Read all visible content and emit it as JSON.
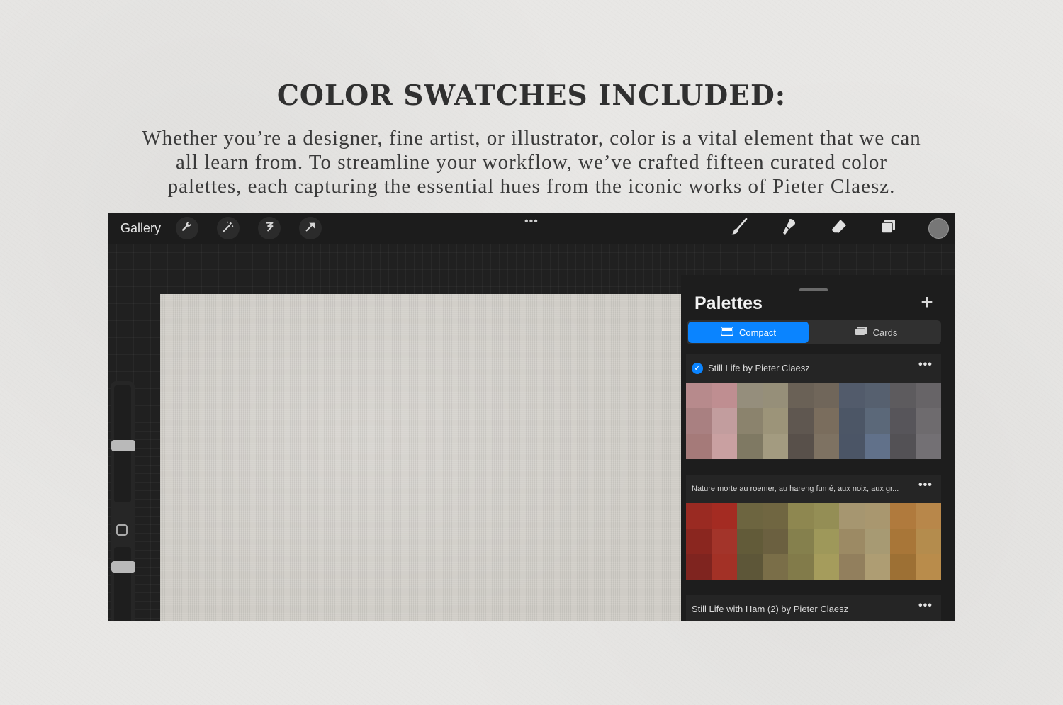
{
  "headline": "COLOR SWATCHES INCLUDED:",
  "intro": "Whether you’re a designer, fine artist, or illustrator, color is a vital element that we can all learn from. To streamline your workflow, we’ve crafted fifteen curated color palettes, each capturing the essential hues from the iconic works of Pieter Claesz.",
  "toolbar": {
    "gallery_label": "Gallery",
    "more_dots": "•••",
    "left_tools": [
      "wrench-icon",
      "magic-wand-icon",
      "selection-icon",
      "transform-arrow-icon"
    ],
    "right_tools": [
      "brush-icon",
      "smudge-icon",
      "eraser-icon",
      "layers-icon"
    ],
    "current_color": "#777777"
  },
  "panel": {
    "title": "Palettes",
    "add_symbol": "+",
    "tabs": [
      {
        "label": "Compact",
        "active": true
      },
      {
        "label": "Cards",
        "active": false
      }
    ]
  },
  "palettes": [
    {
      "name": "Still Life by Pieter Claesz",
      "checked": true,
      "more": "•••",
      "swatches": [
        "#b78a8c",
        "#bf8e91",
        "#958e7c",
        "#968f79",
        "#6a6156",
        "#70665a",
        "#525b6b",
        "#56606f",
        "#5d5b5e",
        "#676467",
        "#a98081",
        "#c29d9e",
        "#8b836d",
        "#9c9479",
        "#5f5750",
        "#7a6d5d",
        "#4c5666",
        "#5b6879",
        "#57555a",
        "#6e6b6e",
        "#a57a79",
        "#c9a0a1",
        "#7f7963",
        "#a39b80",
        "#58504a",
        "#7e7262",
        "#4b5566",
        "#61718a",
        "#535155",
        "#737074"
      ]
    },
    {
      "name": "Nature morte au roemer, au hareng fumé, aux noix, aux gr...",
      "checked": false,
      "more": "•••",
      "swatches": [
        "#9a2a22",
        "#a42b22",
        "#6d6540",
        "#706641",
        "#8e8750",
        "#948e55",
        "#a69670",
        "#a9976f",
        "#b07a3d",
        "#b8874a",
        "#8a261f",
        "#a3342a",
        "#625b39",
        "#6b6040",
        "#85804d",
        "#9e985a",
        "#9c8a64",
        "#a79a73",
        "#a87638",
        "#b48c4d",
        "#7f241f",
        "#a33126",
        "#5d5638",
        "#7a6e48",
        "#827b4a",
        "#a59c5c",
        "#927f5d",
        "#ae9d73",
        "#9d7034",
        "#b98c4b"
      ]
    },
    {
      "name": "Still Life with Ham (2) by Pieter Claesz",
      "checked": false,
      "more": "•••",
      "swatches": [
        "#a67431",
        "#aa7632",
        "#a2501f",
        "#a55423",
        "#7a3e32",
        "#884536",
        "#6e2a1b",
        "#732c1c",
        "#504538",
        "#574a3b"
      ]
    }
  ]
}
